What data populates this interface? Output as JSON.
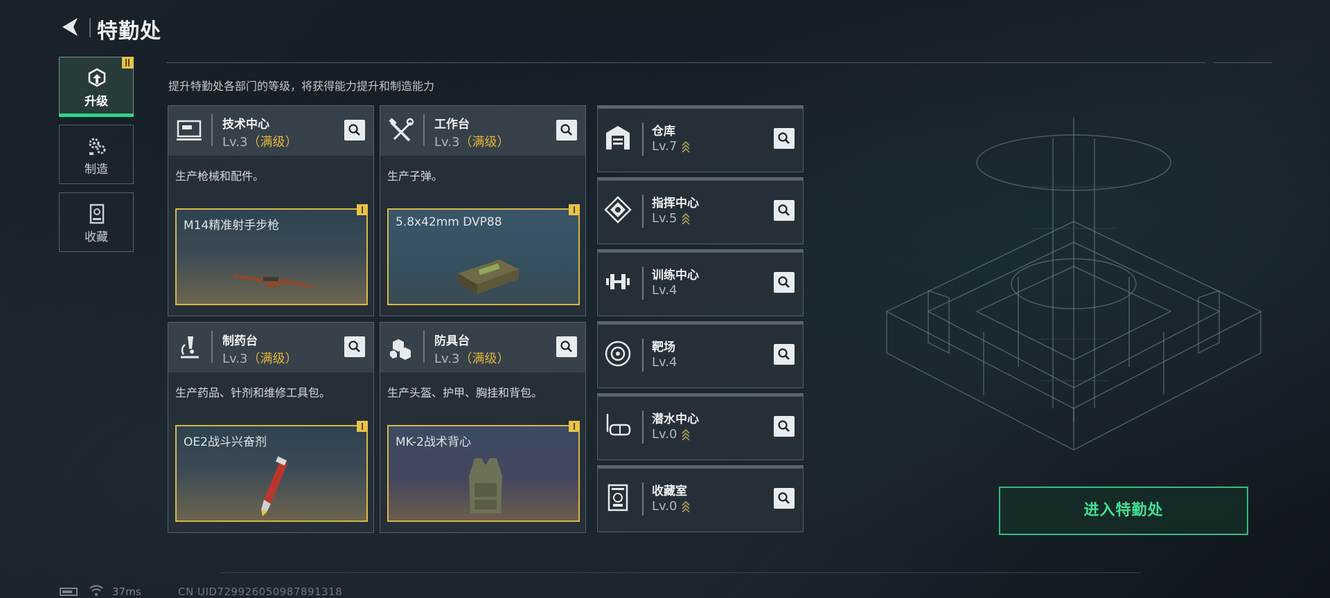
{
  "header": {
    "title": "特勤处"
  },
  "tabs": [
    {
      "label": "升级",
      "active": true
    },
    {
      "label": "制造",
      "active": false
    },
    {
      "label": "收藏",
      "active": false
    }
  ],
  "subtitle": "提升特勤处各部门的等级，将获得能力提升和制造能力",
  "cards": [
    {
      "name": "技术中心",
      "level": "Lv.3",
      "max": "（满级）",
      "desc": "生产枪械和配件。",
      "item": "M14精准射手步枪",
      "icon": "computer-icon"
    },
    {
      "name": "工作台",
      "level": "Lv.3",
      "max": "（满级）",
      "desc": "生产子弹。",
      "item": "5.8x42mm DVP88",
      "icon": "tools-icon"
    },
    {
      "name": "制药台",
      "level": "Lv.3",
      "max": "（满级）",
      "desc": "生产药品、针剂和维修工具包。",
      "item": "OE2战斗兴奋剂",
      "icon": "microscope-icon"
    },
    {
      "name": "防具台",
      "level": "Lv.3",
      "max": "（满级）",
      "desc": "生产头盔、护甲、胸挂和背包。",
      "item": "MK-2战术背心",
      "icon": "armor-icon"
    }
  ],
  "rooms": [
    {
      "name": "仓库",
      "level": "Lv.7",
      "upgradable": true,
      "icon": "warehouse-icon"
    },
    {
      "name": "指挥中心",
      "level": "Lv.5",
      "upgradable": true,
      "icon": "chip-icon"
    },
    {
      "name": "训练中心",
      "level": "Lv.4",
      "upgradable": false,
      "icon": "dumbbell-icon"
    },
    {
      "name": "靶场",
      "level": "Lv.4",
      "upgradable": false,
      "icon": "target-icon"
    },
    {
      "name": "潜水中心",
      "level": "Lv.0",
      "upgradable": true,
      "icon": "dive-mask-icon"
    },
    {
      "name": "收藏室",
      "level": "Lv.0",
      "upgradable": true,
      "icon": "display-case-icon"
    }
  ],
  "enter_button": "进入特勤处",
  "footer": {
    "ping": "37ms",
    "uid": "CN UID729926050987891318"
  },
  "colors": {
    "accent": "#2ed68a",
    "max_level": "#e2b43a",
    "item_border": "#d9b84a"
  }
}
